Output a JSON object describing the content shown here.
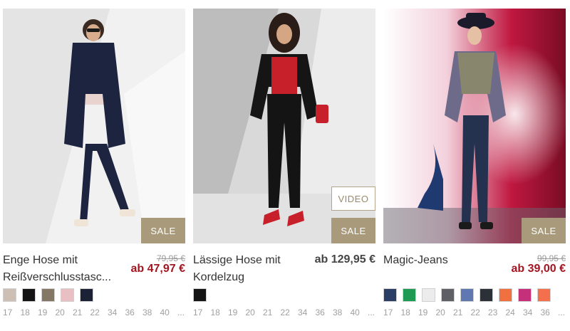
{
  "products": [
    {
      "title": "Enge Hose mit Reißverschlusstasc...",
      "old_price": "79,95 €",
      "price": "ab 47,97 €",
      "badges": {
        "sale": "SALE"
      },
      "colors": [
        "#cdbfb4",
        "#141414",
        "#847766",
        "#e8bfc3",
        "#1c2236"
      ],
      "sizes": [
        "17",
        "18",
        "19",
        "20",
        "21",
        "22",
        "34",
        "36",
        "38",
        "40",
        "..."
      ]
    },
    {
      "title": "Lässige Hose mit Kordelzug",
      "price": "ab 129,95 €",
      "badges": {
        "video": "VIDEO",
        "sale": "SALE"
      },
      "colors": [
        "#141414"
      ],
      "sizes": [
        "17",
        "18",
        "19",
        "20",
        "21",
        "22",
        "34",
        "36",
        "38",
        "40",
        "..."
      ]
    },
    {
      "title": "Magic-Jeans",
      "old_price": "99,95 €",
      "price": "ab 39,00 €",
      "badges": {
        "sale": "SALE"
      },
      "colors": [
        "#2b3f66",
        "#1e9a52",
        "#ececec",
        "#5e6066",
        "#5f78b2",
        "#2c3138",
        "#f07040",
        "#c4307a",
        "#f4704c"
      ],
      "sizes": [
        "17",
        "18",
        "19",
        "20",
        "21",
        "22",
        "23",
        "24",
        "34",
        "36",
        "..."
      ]
    }
  ]
}
